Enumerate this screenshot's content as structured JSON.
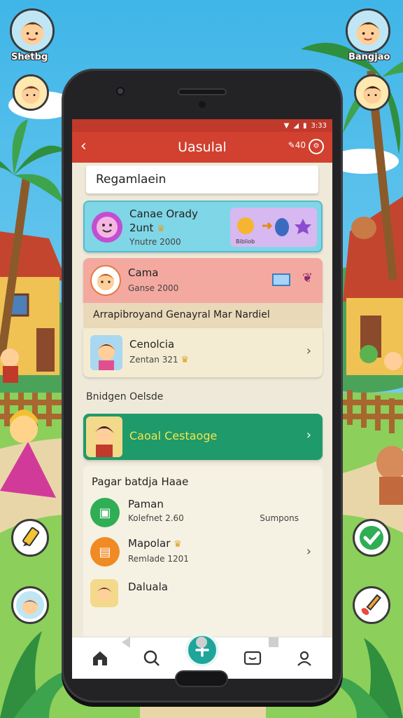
{
  "corner": {
    "top_left_label": "Shetbg",
    "top_right_label": "Bangjao"
  },
  "status": {
    "time": "3:33"
  },
  "appbar": {
    "title": "Uasulal",
    "action_label": "40"
  },
  "search": {
    "text": "Regamlaein"
  },
  "cards": {
    "card1": {
      "title": "Canae Orady",
      "subtitle": "2unt",
      "meta": "Ynutre 2000",
      "art_label": "Bibliob"
    },
    "card2": {
      "title": "Cama",
      "meta": "Ganse 2000"
    },
    "card2_banner": {
      "text": "Arrapibroyand Genayral Mar Nardiel"
    },
    "card3": {
      "title": "Cenolcia",
      "meta": "Zentan 321"
    }
  },
  "section1": {
    "label": "Bnidgen Oelsde"
  },
  "featured": {
    "title": "Caoal Cestaoge"
  },
  "panel": {
    "title": "Pagar batdja Haae",
    "items": [
      {
        "title": "Paman",
        "meta": "Kolefnet 2.60",
        "right": "Sumpons"
      },
      {
        "title": "Mapolar",
        "meta": "Remlade 1201",
        "right": ""
      },
      {
        "title": "Daluala",
        "meta": "",
        "right": ""
      }
    ]
  },
  "colors": {
    "appbar": "#d2402f",
    "statusbar": "#c0392b",
    "card1_bg": "#7fd6e6",
    "card2_bg": "#f4a9a0",
    "banner_bg": "#e9d9b8",
    "card3_bg": "#f3ecd2",
    "featured_bg": "#1f9a6b",
    "fab": "#1fa59a"
  },
  "icons": {
    "back": "arrow-left-icon",
    "nav": [
      "home-icon",
      "search-icon",
      "add-icon",
      "message-icon",
      "profile-icon"
    ],
    "system": [
      "back-triangle-icon",
      "home-circle-icon",
      "recent-square-icon"
    ]
  }
}
